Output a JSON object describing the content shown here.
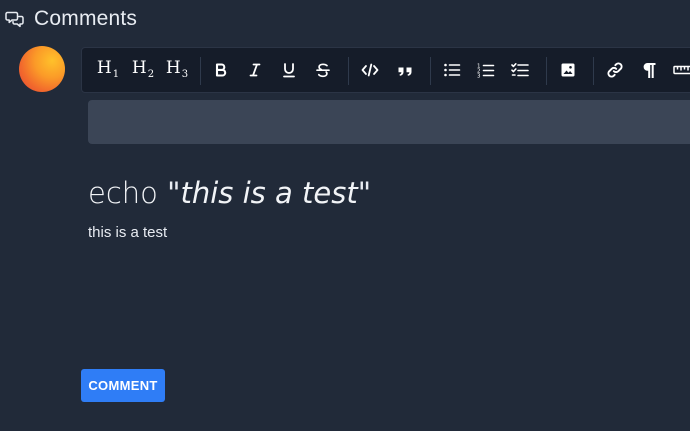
{
  "header": {
    "title": "Comments",
    "icon": "comments-icon"
  },
  "avatar": {
    "gradient_colors": [
      "#ffc12a",
      "#f26a2c",
      "#e44336"
    ]
  },
  "toolbar": {
    "buttons": [
      {
        "name": "heading-1-button",
        "icon": "h1-icon",
        "label": "H",
        "sub": "1"
      },
      {
        "name": "heading-2-button",
        "icon": "h2-icon",
        "label": "H",
        "sub": "2"
      },
      {
        "name": "heading-3-button",
        "icon": "h3-icon",
        "label": "H",
        "sub": "3"
      },
      {
        "name": "bold-button",
        "icon": "bold-icon"
      },
      {
        "name": "italic-button",
        "icon": "italic-icon"
      },
      {
        "name": "underline-button",
        "icon": "underline-icon"
      },
      {
        "name": "strikethrough-button",
        "icon": "strikethrough-icon"
      },
      {
        "name": "code-button",
        "icon": "code-icon"
      },
      {
        "name": "blockquote-button",
        "icon": "quote-icon"
      },
      {
        "name": "bullet-list-button",
        "icon": "bullet-list-icon"
      },
      {
        "name": "ordered-list-button",
        "icon": "ordered-list-icon"
      },
      {
        "name": "task-list-button",
        "icon": "task-list-icon"
      },
      {
        "name": "image-button",
        "icon": "image-icon"
      },
      {
        "name": "link-button",
        "icon": "link-icon"
      },
      {
        "name": "paragraph-button",
        "icon": "paragraph-icon"
      },
      {
        "name": "ruler-button",
        "icon": "ruler-icon"
      }
    ]
  },
  "title_input": {
    "value": "",
    "placeholder": ""
  },
  "editor": {
    "heading_prefix": "echo ",
    "heading_open_quote": "\"",
    "heading_emphasis": "this is a test",
    "heading_close_quote": "\"",
    "paragraph": "this is a test"
  },
  "actions": {
    "comment_label": "COMMENT"
  },
  "colors": {
    "background": "#212a39",
    "toolbar": "#151c29",
    "input": "#3b4556",
    "accent": "#2f7df6"
  }
}
